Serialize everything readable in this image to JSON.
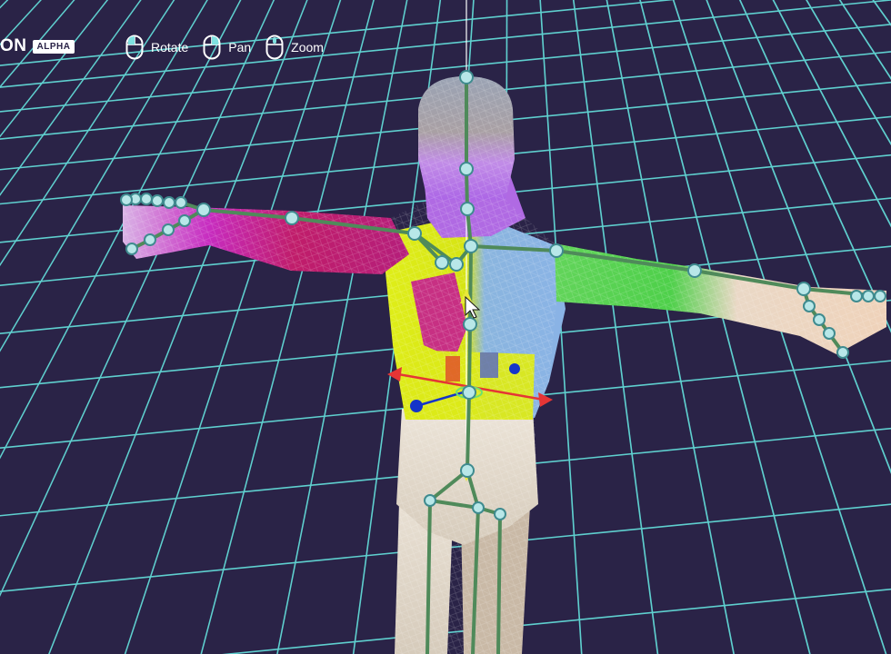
{
  "brand": {
    "name": "ON",
    "badge": "ALPHA"
  },
  "controls": [
    {
      "label": "Rotate",
      "icon": "mouse-left-icon",
      "button": "left"
    },
    {
      "label": "Pan",
      "icon": "mouse-right-icon",
      "button": "right"
    },
    {
      "label": "Zoom",
      "icon": "mouse-wheel-icon",
      "button": "wheel"
    }
  ],
  "colors": {
    "background": "#2a2347",
    "grid": "#5fd0cf",
    "bone": "#4f8a5a",
    "joint_fill": "#b8e7e8",
    "joint_stroke": "#3f8b8f",
    "weight_yellow": "#e2f011",
    "weight_magenta": "#c51f8d",
    "weight_purple": "#a96be0",
    "weight_blue": "#8bb2e2",
    "weight_green": "#5bd44d",
    "skin_base": "#e5dccf",
    "gizmo_x": "#e53535",
    "gizmo_z": "#1534c8",
    "gizmo_y": "#6fe06f"
  }
}
